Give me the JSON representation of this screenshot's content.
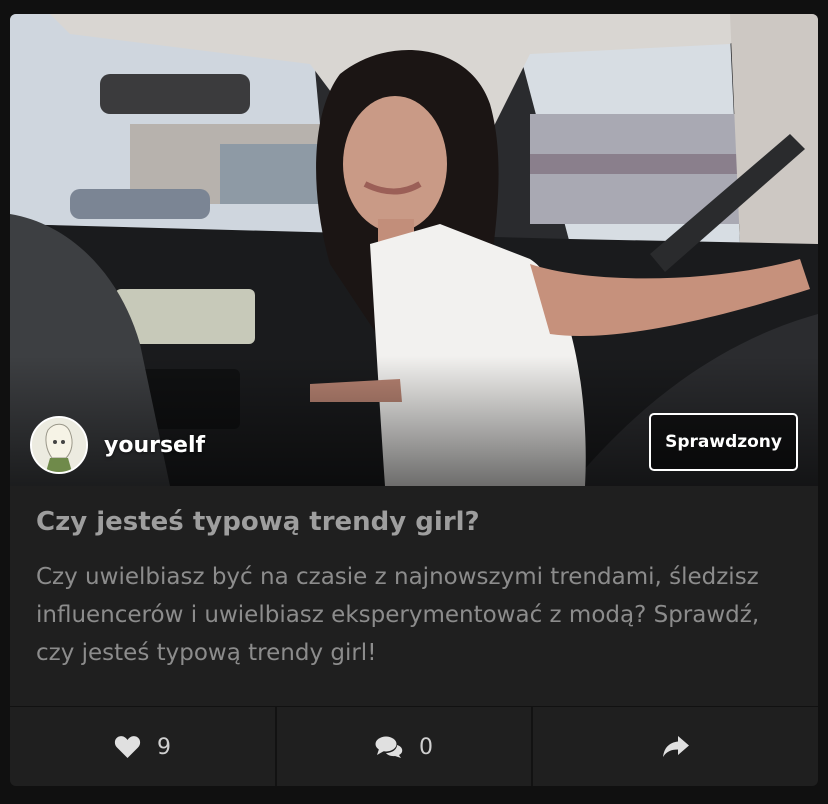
{
  "post": {
    "author": {
      "name": "yourself",
      "avatar_icon": "avatar-illustration"
    },
    "badge": "Sprawdzony",
    "title": "Czy jesteś typową trendy girl?",
    "description": "Czy uwielbiasz być na czasie z najnowszymi trendami, śledzisz influencerów i uwielbiasz eksperymentować z modą? Sprawdź, czy jesteś typową trendy girl!",
    "image_alt_icon": "photo-woman-in-car"
  },
  "actions": {
    "likes": {
      "icon": "heart-icon",
      "count": "9"
    },
    "comments": {
      "icon": "comments-icon",
      "count": "0"
    },
    "share": {
      "icon": "share-icon"
    }
  },
  "colors": {
    "page_bg": "#101010",
    "card_bg": "#1f1f1f",
    "title": "#9e9e9e",
    "text": "#8c8c8c",
    "action_text": "#d0d0d0"
  }
}
